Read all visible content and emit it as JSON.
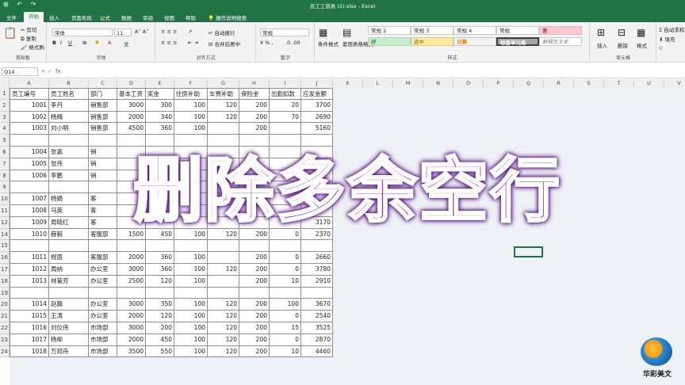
{
  "window": {
    "title": "员工工资表 (2).xlsx  -  Excel",
    "quick_access": "⊞ ↶ ↷"
  },
  "tabs": [
    "文件",
    "开始",
    "插入",
    "页面布局",
    "公式",
    "数据",
    "审阅",
    "视图",
    "帮助",
    "操作说明搜索"
  ],
  "ribbon": {
    "clipboard": {
      "label": "剪贴板",
      "cut": "剪切",
      "copy": "复制",
      "paint": "格式刷"
    },
    "font": {
      "label": "字体",
      "name": "宋体",
      "size": "11"
    },
    "align": {
      "label": "对齐方式",
      "wrap": "自动换行",
      "merge": "合并后居中"
    },
    "number": {
      "label": "数字",
      "format": "常规"
    },
    "styles": {
      "label": "样式",
      "cond": "条件格式",
      "table": "套用表格格式",
      "items": [
        "常规 2",
        "常规 3",
        "常规 4",
        "常规",
        "差",
        "好",
        "适中",
        "计算",
        "检查单元格",
        "解释性文本"
      ]
    },
    "cells": {
      "label": "单元格",
      "insert": "插入",
      "delete": "删除",
      "format": "格式"
    },
    "edit": {
      "sum": "自动求和",
      "fill": "填充"
    }
  },
  "formula_bar": {
    "name_box": "Q14",
    "fx": "fx"
  },
  "columns": [
    "A",
    "B",
    "C",
    "D",
    "E",
    "F",
    "G",
    "H",
    "I",
    "J",
    "K",
    "L",
    "M",
    "N",
    "O",
    "P",
    "Q",
    "R",
    "S",
    "T",
    "U",
    "V"
  ],
  "rows": [
    "1",
    "2",
    "3",
    "4",
    "5",
    "6",
    "7",
    "8",
    "9",
    "10",
    "11",
    "12",
    "14",
    "15",
    "16",
    "17",
    "18",
    "19",
    "20",
    "21",
    "22",
    "23",
    "24"
  ],
  "header_row": [
    "员工编号",
    "员工姓名",
    "部门",
    "基本工资",
    "奖金",
    "住房补助",
    "车费补助",
    "保险金",
    "出勤扣款",
    "应发金额"
  ],
  "table_rows": [
    [
      "1001",
      "李丹",
      "销售部",
      "3000",
      "300",
      "100",
      "120",
      "200",
      "20",
      "3700"
    ],
    [
      "1002",
      "杨梅",
      "销售部",
      "2000",
      "340",
      "100",
      "120",
      "200",
      "70",
      "2690"
    ],
    [
      "1003",
      "刘小明",
      "销售部",
      "4500",
      "360",
      "100",
      "",
      "200",
      "",
      "5160"
    ],
    [
      "",
      "",
      "",
      "",
      "",
      "",
      "",
      "",
      "",
      ""
    ],
    [
      "1004",
      "张嘉",
      "销",
      "",
      "",
      "",
      "",
      "",
      "",
      ""
    ],
    [
      "1005",
      "张伟",
      "销",
      "",
      "",
      "",
      "",
      "",
      "",
      ""
    ],
    [
      "1006",
      "李鹏",
      "销",
      "",
      "",
      "",
      "",
      "",
      "",
      ""
    ],
    [
      "",
      "",
      "",
      "",
      "",
      "",
      "",
      "",
      "",
      ""
    ],
    [
      "1007",
      "杨娟",
      "客",
      "",
      "",
      "",
      "",
      "200",
      "",
      ""
    ],
    [
      "1008",
      "马英",
      "客",
      "",
      "",
      "",
      "",
      "",
      "",
      ""
    ],
    [
      "1009",
      "周晓红",
      "客",
      "",
      "",
      "",
      "",
      "",
      "",
      "3170"
    ],
    [
      "1010",
      "薛毅",
      "客服部",
      "1500",
      "450",
      "100",
      "120",
      "200",
      "0",
      "2370"
    ],
    [
      "",
      "",
      "",
      "",
      "",
      "",
      "",
      "",
      "",
      ""
    ],
    [
      "1011",
      "祝茵",
      "客服部",
      "2000",
      "360",
      "100",
      "",
      "200",
      "0",
      "2660"
    ],
    [
      "1012",
      "周纳",
      "办公室",
      "3000",
      "360",
      "100",
      "120",
      "200",
      "0",
      "3780"
    ],
    [
      "1013",
      "林菊芳",
      "办公室",
      "2500",
      "120",
      "100",
      "",
      "200",
      "10",
      "2910"
    ],
    [
      "",
      "",
      "",
      "",
      "",
      "",
      "",
      "",
      "",
      ""
    ],
    [
      "1014",
      "赵磊",
      "办公室",
      "3000",
      "350",
      "100",
      "120",
      "200",
      "100",
      "3670"
    ],
    [
      "1015",
      "王涛",
      "办公室",
      "2000",
      "120",
      "100",
      "120",
      "200",
      "0",
      "2540"
    ],
    [
      "1016",
      "刘仪伟",
      "市场部",
      "3000",
      "200",
      "100",
      "120",
      "200",
      "15",
      "3525"
    ],
    [
      "1017",
      "杨柳",
      "市场部",
      "2000",
      "450",
      "100",
      "120",
      "200",
      "0",
      "2870"
    ],
    [
      "1018",
      "万邦舟",
      "市场部",
      "3500",
      "550",
      "100",
      "120",
      "200",
      "10",
      "4460"
    ]
  ],
  "overlay_text": "删除多余空行",
  "logo_text": "华彩美文"
}
